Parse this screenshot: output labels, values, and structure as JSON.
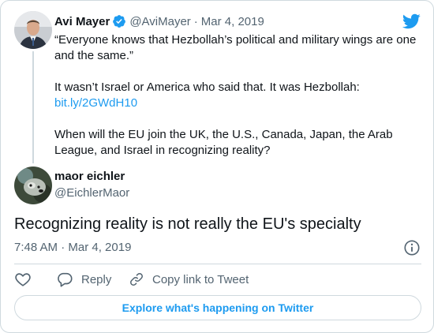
{
  "quoted_tweet": {
    "author_name": "Avi Mayer",
    "author_handle": "@AviMayer",
    "separator": "·",
    "date": "Mar 4, 2019",
    "lines": [
      "“Everyone knows that Hezbollah’s political and military wings are one and the same.”",
      "It wasn’t Israel or America who said that. It was Hezbollah:",
      "bit.ly/2GWdH10",
      "When will the EU join the UK, the U.S., Canada, Japan, the Arab League, and Israel in recognizing reality?"
    ]
  },
  "reply_tweet": {
    "author_name": "maor eichler",
    "author_handle": "@EichlerMaor",
    "text": "Recognizing reality is not really the EU's specialty",
    "timestamp": "7:48 AM · Mar 4, 2019"
  },
  "actions": {
    "reply_label": "Reply",
    "copy_link_label": "Copy link to Tweet"
  },
  "explore_label": "Explore what's happening on Twitter",
  "icons": {
    "verified": "verified-badge-icon",
    "brand": "twitter-bird-icon",
    "info": "info-icon",
    "like": "heart-icon",
    "reply": "speech-bubble-icon",
    "copy_link": "link-icon"
  },
  "colors": {
    "accent": "#1d9bf0",
    "text": "#0f1419",
    "secondary_text": "#536471",
    "border": "#cfd9de"
  }
}
